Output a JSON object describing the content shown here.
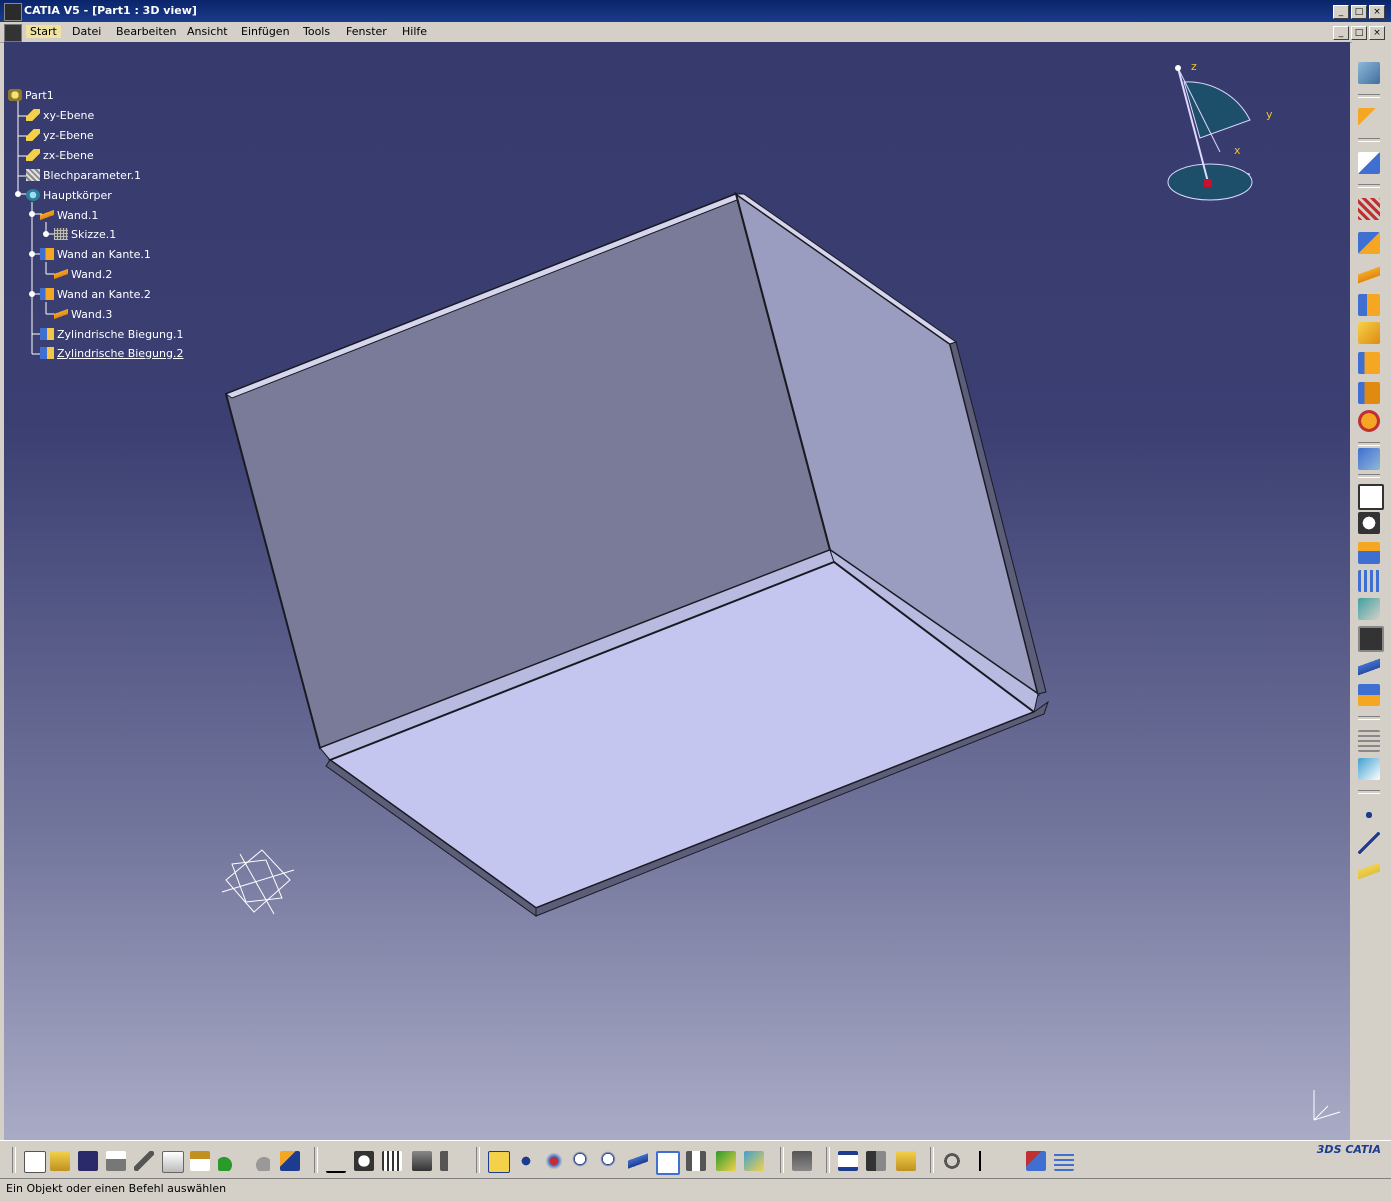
{
  "window": {
    "title": "CATIA V5 - [Part1 : 3D view]",
    "buttons": [
      "_",
      "□",
      "×"
    ]
  },
  "menubar": {
    "items": [
      "Start",
      "Datei",
      "Bearbeiten",
      "Ansicht",
      "Einfügen",
      "Tools",
      "Fenster",
      "Hilfe"
    ],
    "active": "Start"
  },
  "tree": {
    "items": [
      {
        "label": "Part1",
        "icon": "part-icon"
      },
      {
        "label": "xy-Ebene",
        "icon": "plane-icon"
      },
      {
        "label": "yz-Ebene",
        "icon": "plane-icon"
      },
      {
        "label": "zx-Ebene",
        "icon": "plane-icon"
      },
      {
        "label": "Blechparameter.1",
        "icon": "sheetmetal-parameters-icon"
      },
      {
        "label": "Hauptkörper",
        "icon": "body-icon"
      },
      {
        "label": "Wand.1",
        "icon": "wall-icon"
      },
      {
        "label": "Skizze.1",
        "icon": "sketch-icon"
      },
      {
        "label": "Wand an Kante.1",
        "icon": "wall-on-edge-icon"
      },
      {
        "label": "Wand.2",
        "icon": "wall-icon"
      },
      {
        "label": "Wand an Kante.2",
        "icon": "wall-on-edge-icon"
      },
      {
        "label": "Wand.3",
        "icon": "wall-icon"
      },
      {
        "label": "Zylindrische Biegung.1",
        "icon": "cylindrical-bend-icon"
      },
      {
        "label": "Zylindrische Biegung.2",
        "icon": "cylindrical-bend-icon"
      }
    ]
  },
  "compass": {
    "z": "z",
    "y": "y",
    "x": "x"
  },
  "status": {
    "text": "Ein Objekt oder einen Befehl auswählen"
  },
  "logo": {
    "text": "CATIA",
    "mark": "3DS"
  },
  "colors": {
    "viewport_top": "#363a6c",
    "viewport_bottom": "#a9abc6",
    "tree_text": "#ffffff",
    "part_face_light": "#c5c6ef",
    "part_face_mid": "#9b9dc0",
    "part_face_dark": "#7a7b98",
    "compass_label": "#f1c232"
  }
}
